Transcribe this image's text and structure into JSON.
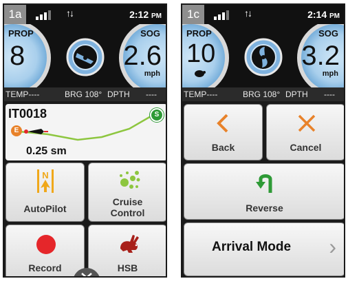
{
  "screen_a": {
    "tag": "1a",
    "time": "2:12",
    "ampm": "PM",
    "prop_label": "PROP",
    "prop_value": "8",
    "sog_label": "SOG",
    "sog_value": "2.6",
    "sog_unit": "mph",
    "info": {
      "temp": "TEMP----",
      "brg": "BRG 108°",
      "dpth": "DPTH",
      "dpth_value": "----"
    },
    "route_name": "IT0018",
    "route_start": "S",
    "route_end": "E",
    "route_distance": "0.25 sm",
    "buttons": [
      {
        "label": "AutoPilot",
        "icon": "autopilot-icon"
      },
      {
        "label": "Cruise Control",
        "label_line1": "Cruise",
        "label_line2": "Control",
        "icon": "cruise-control-icon"
      },
      {
        "label": "Record",
        "icon": "record-icon"
      },
      {
        "label": "HSB",
        "icon": "rabbit-icon"
      }
    ]
  },
  "screen_b": {
    "tag": "1c",
    "time": "2:14",
    "ampm": "PM",
    "prop_label": "PROP",
    "prop_value": "10",
    "sog_label": "SOG",
    "sog_value": "3.2",
    "sog_unit": "mph",
    "info": {
      "temp": "TEMP----",
      "brg": "BRG 108°",
      "dpth": "DPTH",
      "dpth_value": "----"
    },
    "buttons": [
      {
        "label": "Back",
        "icon": "chevron-left-icon"
      },
      {
        "label": "Cancel",
        "icon": "x-icon"
      },
      {
        "label": "Reverse",
        "icon": "u-turn-icon"
      }
    ],
    "arrival_label": "Arrival Mode",
    "arrival_chevron": "›"
  },
  "colors": {
    "orange": "#e8822a",
    "green": "#2e9a36",
    "red": "#e5262a",
    "gauge_blue": "#7fb2de"
  }
}
